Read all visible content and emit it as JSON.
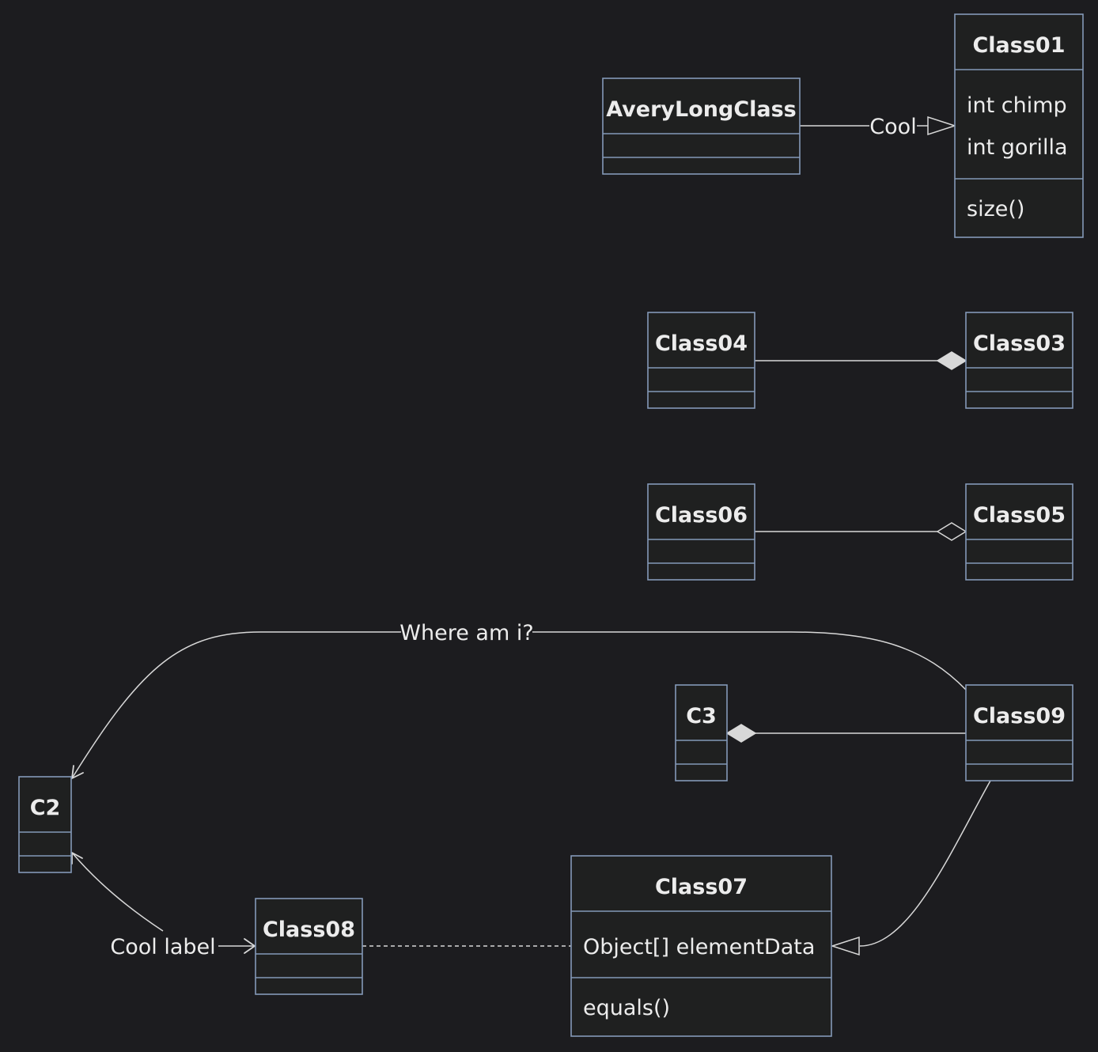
{
  "diagram": {
    "type": "class-diagram",
    "classes": [
      {
        "id": "AveryLongClass",
        "name": "AveryLongClass",
        "attributes": [],
        "methods": []
      },
      {
        "id": "Class01",
        "name": "Class01",
        "attributes": [
          "int chimp",
          "int gorilla"
        ],
        "methods": [
          "size()"
        ]
      },
      {
        "id": "Class04",
        "name": "Class04",
        "attributes": [],
        "methods": []
      },
      {
        "id": "Class03",
        "name": "Class03",
        "attributes": [],
        "methods": []
      },
      {
        "id": "Class06",
        "name": "Class06",
        "attributes": [],
        "methods": []
      },
      {
        "id": "Class05",
        "name": "Class05",
        "attributes": [],
        "methods": []
      },
      {
        "id": "C3",
        "name": "C3",
        "attributes": [],
        "methods": []
      },
      {
        "id": "Class09",
        "name": "Class09",
        "attributes": [],
        "methods": []
      },
      {
        "id": "C2",
        "name": "C2",
        "attributes": [],
        "methods": []
      },
      {
        "id": "Class08",
        "name": "Class08",
        "attributes": [],
        "methods": []
      },
      {
        "id": "Class07",
        "name": "Class07",
        "attributes": [
          "Object[] elementData"
        ],
        "methods": [
          "equals()"
        ]
      }
    ],
    "relations": [
      {
        "id": "rel-averylong-class01",
        "from": "AveryLongClass",
        "to": "Class01",
        "kind": "inheritance",
        "label": "Cool"
      },
      {
        "id": "rel-class04-class03",
        "from": "Class04",
        "to": "Class03",
        "kind": "composition",
        "label": ""
      },
      {
        "id": "rel-class06-class05",
        "from": "Class06",
        "to": "Class05",
        "kind": "aggregation",
        "label": ""
      },
      {
        "id": "rel-class09-c3",
        "from": "Class09",
        "to": "C3",
        "kind": "composition",
        "label": ""
      },
      {
        "id": "rel-class09-c2",
        "from": "Class09",
        "to": "C2",
        "kind": "association",
        "label": "Where am i?"
      },
      {
        "id": "rel-class09-class07",
        "from": "Class09",
        "to": "Class07",
        "kind": "inheritance",
        "label": ""
      },
      {
        "id": "rel-class08-class07",
        "from": "Class08",
        "to": "Class07",
        "kind": "dependency-line",
        "label": ""
      },
      {
        "id": "rel-class08-c2",
        "from": "Class08",
        "to": "C2",
        "kind": "bidirectional-association",
        "label": "Cool label"
      }
    ]
  }
}
